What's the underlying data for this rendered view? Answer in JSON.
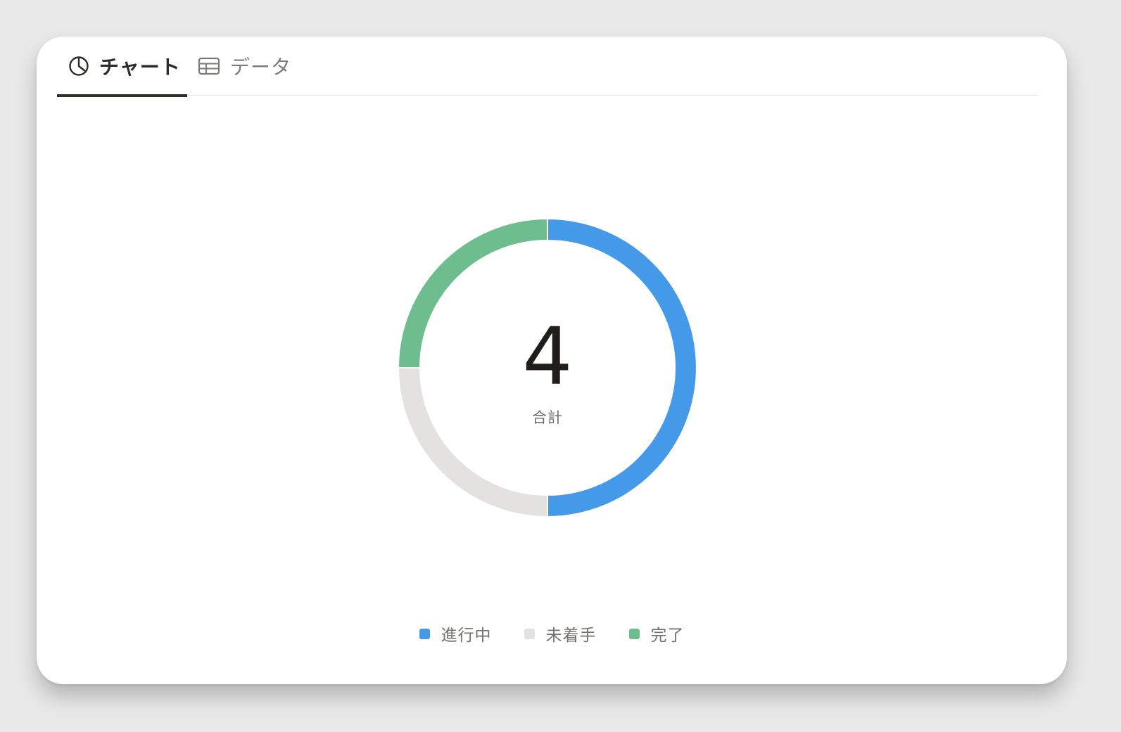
{
  "tabs": [
    {
      "label": "チャート",
      "icon": "pie-chart-icon",
      "active": true
    },
    {
      "label": "データ",
      "icon": "table-icon",
      "active": false
    }
  ],
  "chart_data": {
    "type": "pie",
    "variant": "donut",
    "center_value": "4",
    "center_label": "合計",
    "categories": [
      "進行中",
      "未着手",
      "完了"
    ],
    "values": [
      2,
      1,
      1
    ],
    "colors": [
      "#4499e8",
      "#e3e2e0",
      "#6ebd8f"
    ],
    "start_angle": "12 o'clock",
    "direction": "clockwise",
    "legend": {
      "position": "bottom",
      "entries": [
        "進行中",
        "未着手",
        "完了"
      ]
    }
  }
}
